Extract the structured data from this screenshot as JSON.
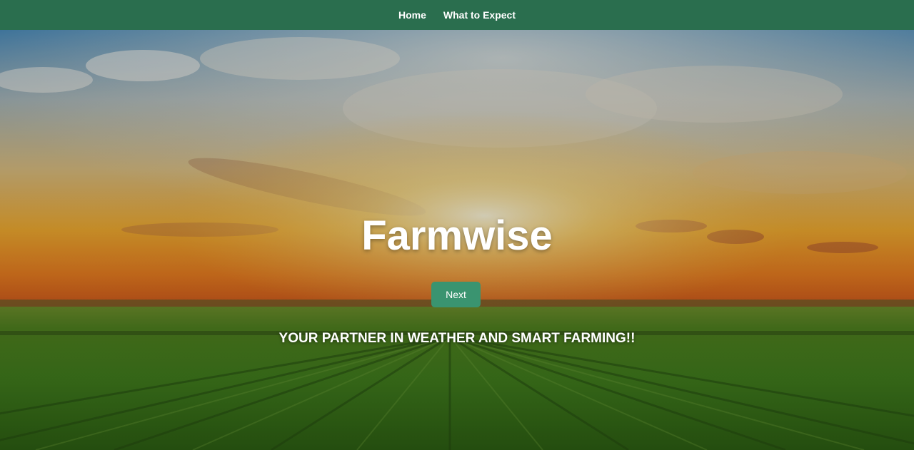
{
  "nav": {
    "items": [
      {
        "label": "Home"
      },
      {
        "label": "What to Expect"
      }
    ]
  },
  "hero": {
    "title": "Farmwise",
    "next_label": "Next",
    "tagline": "YOUR PARTNER IN WEATHER AND SMART FARMING!!"
  },
  "colors": {
    "navbar": "#2a6e4e",
    "button": "#3a9470",
    "text": "#ffffff"
  }
}
